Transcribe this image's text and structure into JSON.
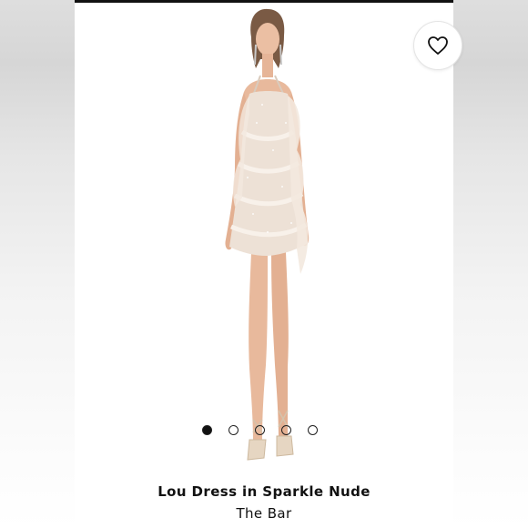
{
  "product": {
    "name": "Lou Dress in Sparkle Nude",
    "brand": "The Bar"
  },
  "gallery": {
    "image_count": 5,
    "active_index": 0
  },
  "icons": {
    "favorite": "heart-outline-icon"
  },
  "colors": {
    "text": "#111111",
    "dress": "#ede1d6",
    "skin": "#e8b99c"
  }
}
